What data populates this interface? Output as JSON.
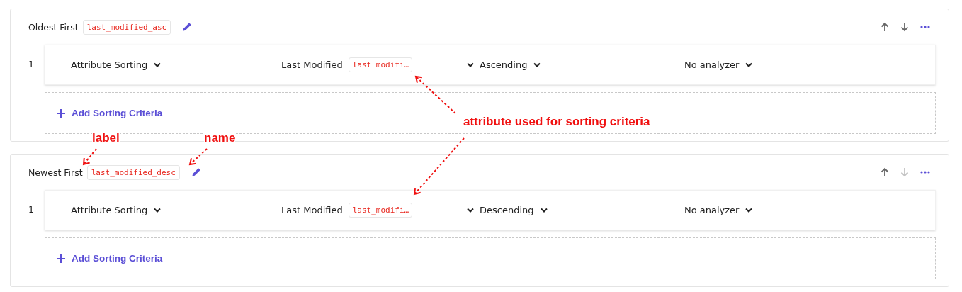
{
  "sorts": [
    {
      "label": "Oldest First",
      "name": "last_modified_asc",
      "move_up": {
        "disabled": false
      },
      "move_down": {
        "disabled": false
      },
      "criteria": [
        {
          "index": "1",
          "type": "Attribute Sorting",
          "attribute_label": "Last Modified",
          "attribute_name": "last_modifi…",
          "order": "Ascending",
          "analyzer": "No analyzer"
        }
      ],
      "add_label": "Add Sorting Criteria"
    },
    {
      "label": "Newest First",
      "name": "last_modified_desc",
      "move_up": {
        "disabled": false
      },
      "move_down": {
        "disabled": true
      },
      "criteria": [
        {
          "index": "1",
          "type": "Attribute Sorting",
          "attribute_label": "Last Modified",
          "attribute_name": "last_modifi…",
          "order": "Descending",
          "analyzer": "No analyzer"
        }
      ],
      "add_label": "Add Sorting Criteria"
    }
  ],
  "annotations": [
    {
      "text": "attribute used for sorting criteria"
    },
    {
      "text": "label"
    },
    {
      "text": "name"
    }
  ]
}
